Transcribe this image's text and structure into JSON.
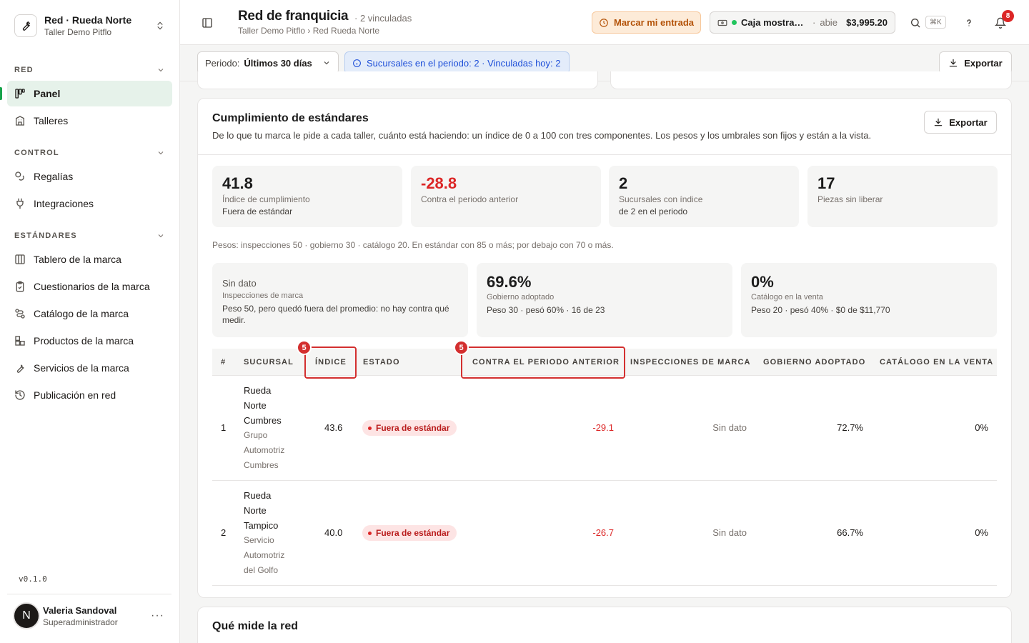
{
  "sidebar": {
    "org": {
      "name": "Red · Rueda Norte",
      "subtitle": "Taller Demo Pitflo"
    },
    "sections": [
      {
        "label": "RED"
      },
      {
        "label": "CONTROL"
      },
      {
        "label": "ESTÁNDARES"
      }
    ],
    "items": [
      {
        "label": "Panel",
        "icon": "panel-icon",
        "active": true
      },
      {
        "label": "Talleres",
        "icon": "building-icon"
      },
      {
        "label": "Regalías",
        "icon": "coins-icon"
      },
      {
        "label": "Integraciones",
        "icon": "plug-icon"
      },
      {
        "label": "Tablero de la marca",
        "icon": "columns-icon"
      },
      {
        "label": "Cuestionarios de la marca",
        "icon": "clipboard-icon"
      },
      {
        "label": "Catálogo de la marca",
        "icon": "route-icon"
      },
      {
        "label": "Productos de la marca",
        "icon": "boxes-icon"
      },
      {
        "label": "Servicios de la marca",
        "icon": "wrench-icon"
      },
      {
        "label": "Publicación en red",
        "icon": "history-icon"
      }
    ],
    "version": "v0.1.0",
    "user": {
      "initial": "N",
      "name": "Valeria Sandoval",
      "role": "Superadministrador"
    }
  },
  "header": {
    "title": "Red de franquicia",
    "meta": "· 2 vinculadas",
    "breadcrumb": "Taller Demo Pitflo › Red Rueda Norte",
    "clock_in_label": "Marcar mi entrada",
    "cash": {
      "name": "Caja mostrador",
      "separator": "·",
      "status": "abie",
      "amount": "$3,995.20"
    },
    "shortcut": "⌘K",
    "notifications": "8"
  },
  "filters": {
    "period_label": "Periodo:",
    "period_value": "Últimos 30 días",
    "info": "Sucursales en el periodo: 2 · Vinculadas hoy: 2",
    "export_label": "Exportar"
  },
  "compliance": {
    "title": "Cumplimiento de estándares",
    "description": "De lo que tu marca le pide a cada taller, cuánto está haciendo: un índice de 0 a 100 con tres componentes. Los pesos y los umbrales son fijos y están a la vista.",
    "export_label": "Exportar",
    "kpis": [
      {
        "value": "41.8",
        "label": "Índice de cumplimiento",
        "sub": "Fuera de estándar"
      },
      {
        "value": "-28.8",
        "label": "Contra el periodo anterior",
        "sub": ""
      },
      {
        "value": "2",
        "label": "Sucursales con índice",
        "sub": "de 2 en el periodo"
      },
      {
        "value": "17",
        "label": "Piezas sin liberar",
        "sub": ""
      }
    ],
    "weights_note": "Pesos: inspecciones 50 · gobierno 30 · catálogo 20. En estándar con 85 o más; por debajo con 70 o más.",
    "components": [
      {
        "value": "Sin dato",
        "label": "Inspecciones de marca",
        "sub": "Peso 50, pero quedó fuera del promedio: no hay contra qué medir."
      },
      {
        "value": "69.6%",
        "label": "Gobierno adoptado",
        "sub": "Peso 30 · pesó 60% · 16 de 23"
      },
      {
        "value": "0%",
        "label": "Catálogo en la venta",
        "sub": "Peso 20 · pesó 40% · $0 de $11,770"
      }
    ],
    "table": {
      "columns": [
        "#",
        "SUCURSAL",
        "ÍNDICE",
        "ESTADO",
        "CONTRA EL PERIODO ANTERIOR",
        "INSPECCIONES DE MARCA",
        "GOBIERNO ADOPTADO",
        "CATÁLOGO EN LA VENTA"
      ],
      "rows": [
        {
          "num": "1",
          "name_lines": [
            "Rueda",
            "Norte",
            "Cumbres"
          ],
          "org_lines": [
            "Grupo",
            "Automotriz",
            "Cumbres"
          ],
          "index": "43.6",
          "status": "Fuera de estándar",
          "delta": "-29.1",
          "inspections": "Sin dato",
          "governance": "72.7%",
          "catalog": "0%"
        },
        {
          "num": "2",
          "name_lines": [
            "Rueda",
            "Norte",
            "Tampico"
          ],
          "org_lines": [
            "Servicio",
            "Automotriz",
            "del Golfo"
          ],
          "index": "40.0",
          "status": "Fuera de estándar",
          "delta": "-26.7",
          "inspections": "Sin dato",
          "governance": "66.7%",
          "catalog": "0%"
        }
      ]
    },
    "highlights": [
      {
        "badge": "5"
      },
      {
        "badge": "5"
      }
    ]
  },
  "next_section": {
    "title": "Qué mide la red"
  },
  "colors": {
    "accent": "#16a34a",
    "negative": "#dc2626",
    "warning": "#b45309",
    "info": "#1d4ed8",
    "highlight": "#d32f2f"
  }
}
